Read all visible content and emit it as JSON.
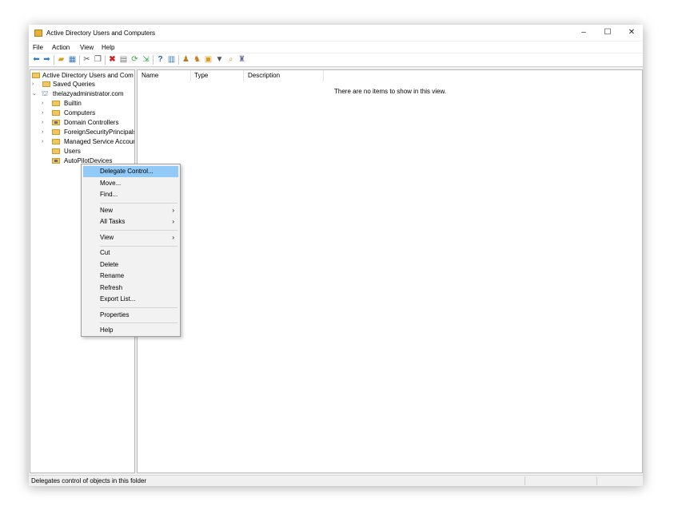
{
  "window": {
    "title": "Active Directory Users and Computers",
    "controls": {
      "minimize": "–",
      "maximize": "☐",
      "close": "✕"
    }
  },
  "menubar": [
    "File",
    "Action",
    "View",
    "Help"
  ],
  "toolbar_icons": [
    "back-arrow-icon",
    "forward-arrow-icon",
    "up-folder-icon",
    "show-console-tree-icon",
    "cut-icon",
    "copy-icon",
    "delete-icon",
    "properties-icon",
    "refresh-icon",
    "export-list-icon",
    "help-icon",
    "show-action-pane-icon",
    "new-user-icon",
    "new-group-icon",
    "new-ou-icon",
    "filter-icon",
    "find-icon",
    "add-to-group-icon"
  ],
  "tree": {
    "root": "Active Directory Users and Com",
    "items": [
      {
        "label": "Saved Queries"
      },
      {
        "label": "thelazyadministrator.com"
      },
      {
        "label": "Builtin"
      },
      {
        "label": "Computers"
      },
      {
        "label": "Domain Controllers"
      },
      {
        "label": "ForeignSecurityPrincipals"
      },
      {
        "label": "Managed Service Accour"
      },
      {
        "label": "Users"
      },
      {
        "label": "AutoPilotDevices"
      }
    ]
  },
  "list": {
    "columns": [
      "Name",
      "Type",
      "Description"
    ],
    "empty_message": "There are no items to show in this view."
  },
  "context_menu": {
    "items": [
      {
        "label": "Delegate Control...",
        "highlighted": true
      },
      {
        "label": "Move..."
      },
      {
        "label": "Find..."
      },
      {
        "label": "New",
        "submenu": "›"
      },
      {
        "label": "All Tasks",
        "submenu": "›"
      },
      {
        "label": "View",
        "submenu": "›"
      },
      {
        "label": "Cut"
      },
      {
        "label": "Delete"
      },
      {
        "label": "Rename"
      },
      {
        "label": "Refresh"
      },
      {
        "label": "Export List..."
      },
      {
        "label": "Properties"
      },
      {
        "label": "Help"
      }
    ]
  },
  "statusbar": {
    "text": "Delegates control of objects in this folder"
  },
  "colors": {
    "highlight": "#91c9f7",
    "folder": "#f1c860"
  }
}
